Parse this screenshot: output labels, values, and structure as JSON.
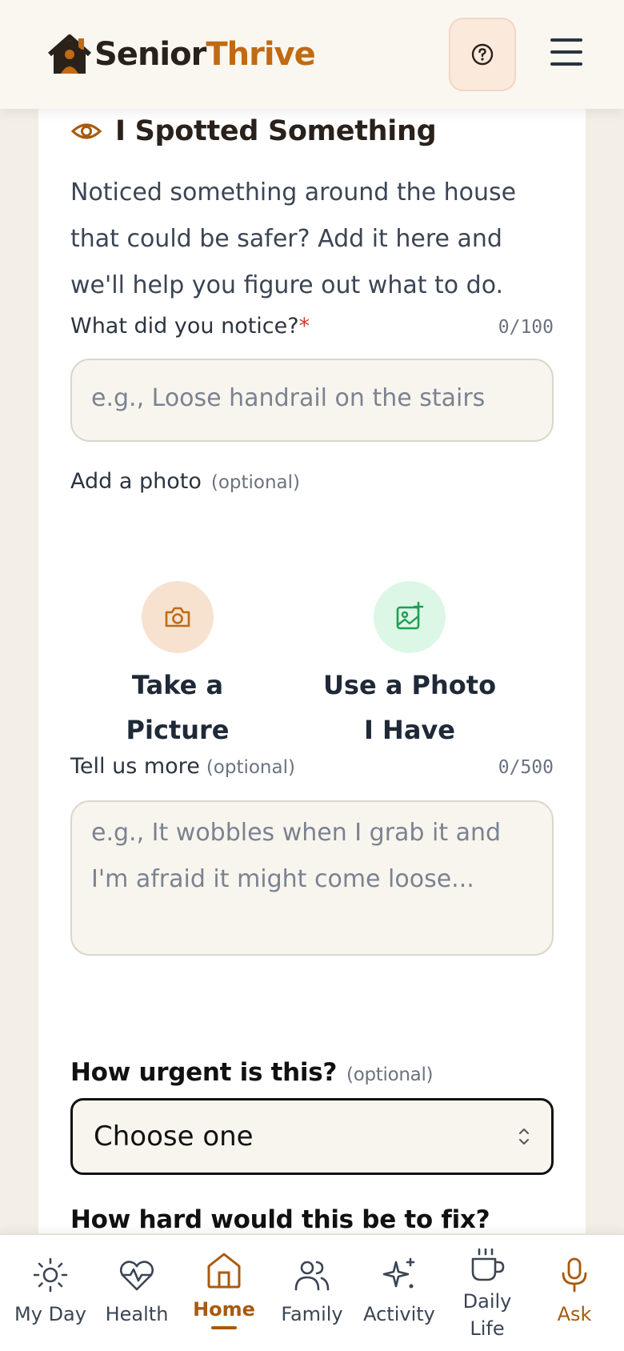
{
  "brand": {
    "name_part1": "Senior",
    "name_part2": "Thrive",
    "accent": "#c06a12"
  },
  "header": {
    "help_icon": "help-circle-icon",
    "menu_icon": "hamburger-menu-icon"
  },
  "form": {
    "title": "I Spotted Something",
    "intro": "Noticed something around the house that could be safer? Add it here and we'll help you figure out what to do.",
    "notice": {
      "label": "What did you notice?",
      "required_mark": "*",
      "counter": "0/100",
      "placeholder": "e.g., Loose handrail on the stairs"
    },
    "photo": {
      "label": "Add a photo",
      "optional": "(optional)",
      "take_line1": "Take a",
      "take_line2": "Picture",
      "use_line1": "Use a Photo",
      "use_line2": "I Have"
    },
    "more": {
      "label": "Tell us more",
      "optional": "(optional)",
      "counter": "0/500",
      "placeholder": "e.g., It wobbles when I grab it and I'm afraid it might come loose..."
    },
    "urgency": {
      "label": "How urgent is this?",
      "optional": "(optional)",
      "selected": "Choose one"
    },
    "difficulty": {
      "label": "How hard would this be to fix?"
    }
  },
  "nav": {
    "items": [
      {
        "label": "My Day",
        "icon": "sun-icon"
      },
      {
        "label": "Health",
        "icon": "heart-pulse-icon"
      },
      {
        "label": "Home",
        "icon": "house-icon",
        "active": true
      },
      {
        "label": "Family",
        "icon": "users-icon"
      },
      {
        "label": "Activity",
        "icon": "sparkles-icon"
      },
      {
        "label_line1": "Daily",
        "label_line2": "Life",
        "icon": "coffee-cup-icon"
      },
      {
        "label": "Ask",
        "icon": "microphone-icon"
      }
    ]
  }
}
